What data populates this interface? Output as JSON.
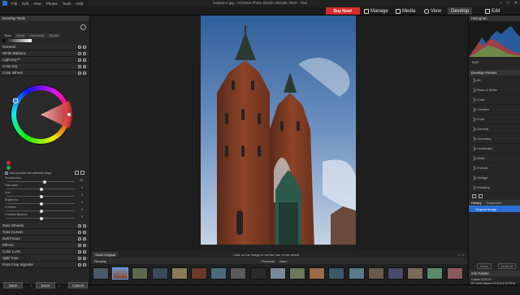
{
  "titlebar": {
    "menu": [
      "File",
      "Edit",
      "View",
      "Photos",
      "Tools",
      "Help"
    ],
    "title": "krakow-2.jpg - ACDSee Photo Studio Ultimate 2023 - Trial"
  },
  "modebar": {
    "buy_now": "Buy Now!",
    "modes": [
      "Manage",
      "Media",
      "View",
      "Develop",
      "Edit"
    ],
    "active_mode": "Develop"
  },
  "left_panel": {
    "header": "Develop Tools",
    "tabs": [
      "Tune",
      "Detail",
      "Geometry",
      "Repair"
    ],
    "sections_top": [
      "General",
      "White Balance",
      "Light EQ™",
      "Color EQ"
    ],
    "color_wheel": {
      "title": "Color Wheel",
      "checkbox_label": "Auto preview the selected range",
      "sliders": [
        {
          "label": "Smoothness",
          "value": "20",
          "fraction": 0.55
        },
        {
          "label": "Saturation",
          "value": "0",
          "fraction": 0.5
        },
        {
          "label": "Hue",
          "value": "0",
          "fraction": 0.5
        },
        {
          "label": "Brightness",
          "value": "0",
          "fraction": 0.5
        },
        {
          "label": "Contrast",
          "value": "0",
          "fraction": 0.5
        },
        {
          "label": "Contrast Balance",
          "value": "0",
          "fraction": 0.5
        }
      ]
    },
    "sections_bottom": [
      "Tone Wheels",
      "Tone Curves",
      "Soft Focus",
      "Effects",
      "Color LUTs",
      "Split Tone",
      "Post-Crop Vignette"
    ]
  },
  "bottom_buttons": {
    "save": "Save",
    "done": "Done",
    "cancel": "Cancel"
  },
  "status": {
    "show_original": "Show Original",
    "hint": "Click on the image to set the hue of the wheel.",
    "right_info": "1 / 1"
  },
  "filmstrip": {
    "title": "Filmstrip",
    "previous": "Previous",
    "next": "Next"
  },
  "right_panel": {
    "histogram_title": "Histogram",
    "exif_badge": "EXIF",
    "presets_title": "Develop Presets",
    "presets": [
      "All",
      "Black & White",
      "Color",
      "Creative",
      "Food",
      "General",
      "Geometry",
      "Landscape",
      "Matte",
      "Portrait",
      "Vintage",
      "Wedding"
    ],
    "history_tabs": [
      "History",
      "Snapshots"
    ],
    "history_item": "Original Image",
    "undo": "Undo",
    "undo_all": "Undo All",
    "info_title": "Info Palette",
    "camera": "Canon EOS M",
    "lens": "EF-M18-55mm f/3.5-5.6 IS STM",
    "exposure": [
      "100",
      "f/7.1",
      "1/500s"
    ],
    "date": "05/26/2017 13:"
  },
  "colors": {
    "accent_blue": "#2a6fd6",
    "buy_red": "#d42c2c"
  }
}
